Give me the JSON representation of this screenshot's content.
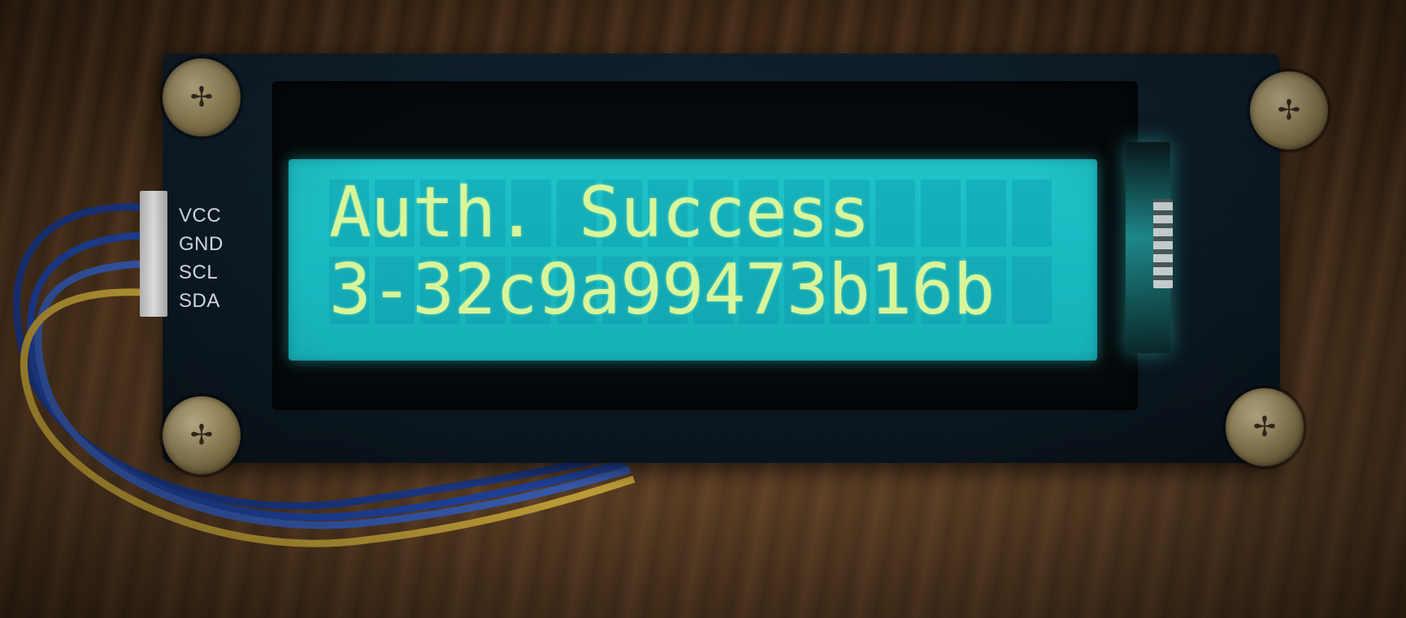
{
  "module": {
    "pins": [
      "VCC",
      "GND",
      "SCL",
      "SDA"
    ]
  },
  "lcd": {
    "line1": "Auth. Success",
    "line2": "3-32c9a99473b16b",
    "backlight_color": "#1fc3c8",
    "text_color": "#d8f59a"
  }
}
